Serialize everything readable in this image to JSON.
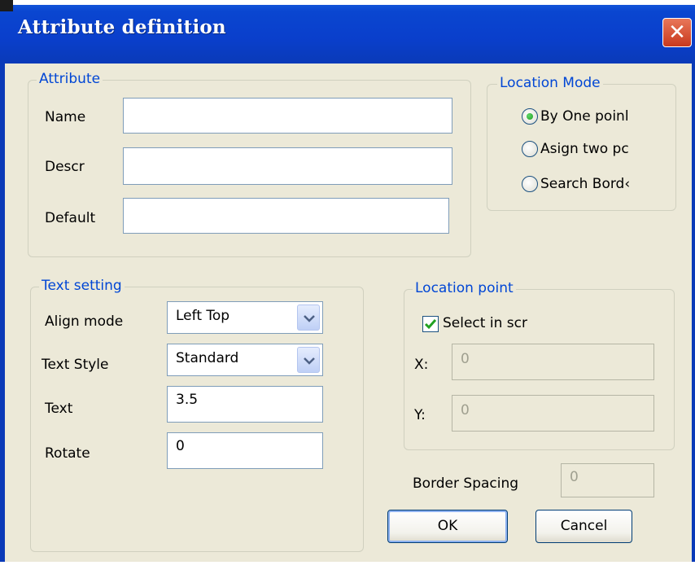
{
  "window": {
    "title": "Attribute definition",
    "close_label": "✕"
  },
  "attribute_group": {
    "legend": "Attribute",
    "name_label": "Name",
    "name_value": "",
    "descr_label": "Descr",
    "descr_value": "",
    "default_label": "Default",
    "default_value": ""
  },
  "location_mode": {
    "legend": "Location Mode",
    "options": [
      {
        "label": "By One point",
        "checked": true
      },
      {
        "label": "Asign two points",
        "checked": false
      },
      {
        "label": "Search Border",
        "checked": false
      }
    ],
    "visible_labels": [
      "By One poinl",
      "Asign two pc",
      "Search Bord‹"
    ]
  },
  "text_setting": {
    "legend": "Text setting",
    "align_mode_label": "Align mode",
    "align_mode_value": "Left Top",
    "text_style_label": "Text Style",
    "text_style_value": "Standard",
    "text_label": "Text",
    "text_value": "3.5",
    "rotate_label": "Rotate",
    "rotate_value": "0"
  },
  "location_point": {
    "legend": "Location point",
    "select_in_screen_label": "Select in scr",
    "select_in_screen_checked": true,
    "x_label": "X:",
    "x_value": "0",
    "y_label": "Y:",
    "y_value": "0"
  },
  "border_spacing": {
    "label": "Border Spacing",
    "value": "0"
  },
  "buttons": {
    "ok": "OK",
    "cancel": "Cancel"
  },
  "colors": {
    "title_bar": "#0a3fcc",
    "dialog_bg": "#ece9d8",
    "legend_text": "#0046d5",
    "close_button": "#d8573a"
  }
}
